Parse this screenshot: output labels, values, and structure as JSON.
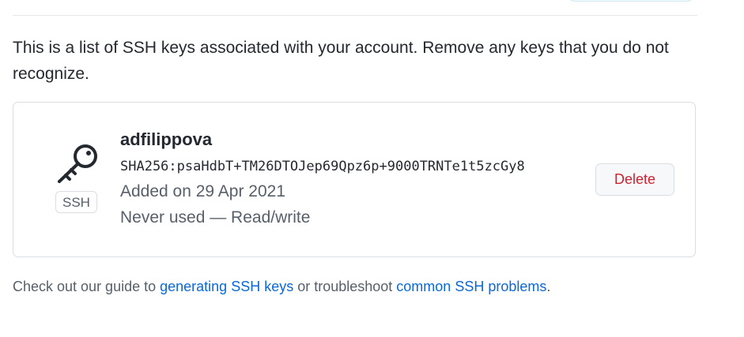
{
  "intro": {
    "text": "This is a list of SSH keys associated with your account. Remove any keys that you do not recognize."
  },
  "ssh_key": {
    "icon": "key-icon",
    "badge": "SSH",
    "title": "adfilippova",
    "fingerprint": "SHA256:psaHdbT+TM26DTOJep69Qpz6p+9000TRNTe1t5zcGy8",
    "added": "Added on 29 Apr 2021",
    "usage": "Never used — Read/write",
    "delete_label": "Delete"
  },
  "footer": {
    "prefix": "Check out our guide to ",
    "guide_link": "generating SSH keys",
    "middle": " or troubleshoot ",
    "problems_link": "common SSH problems",
    "suffix": "."
  },
  "colors": {
    "link": "#0969da",
    "danger": "#cf222e",
    "muted": "#57606a",
    "border": "#d8dee4"
  }
}
